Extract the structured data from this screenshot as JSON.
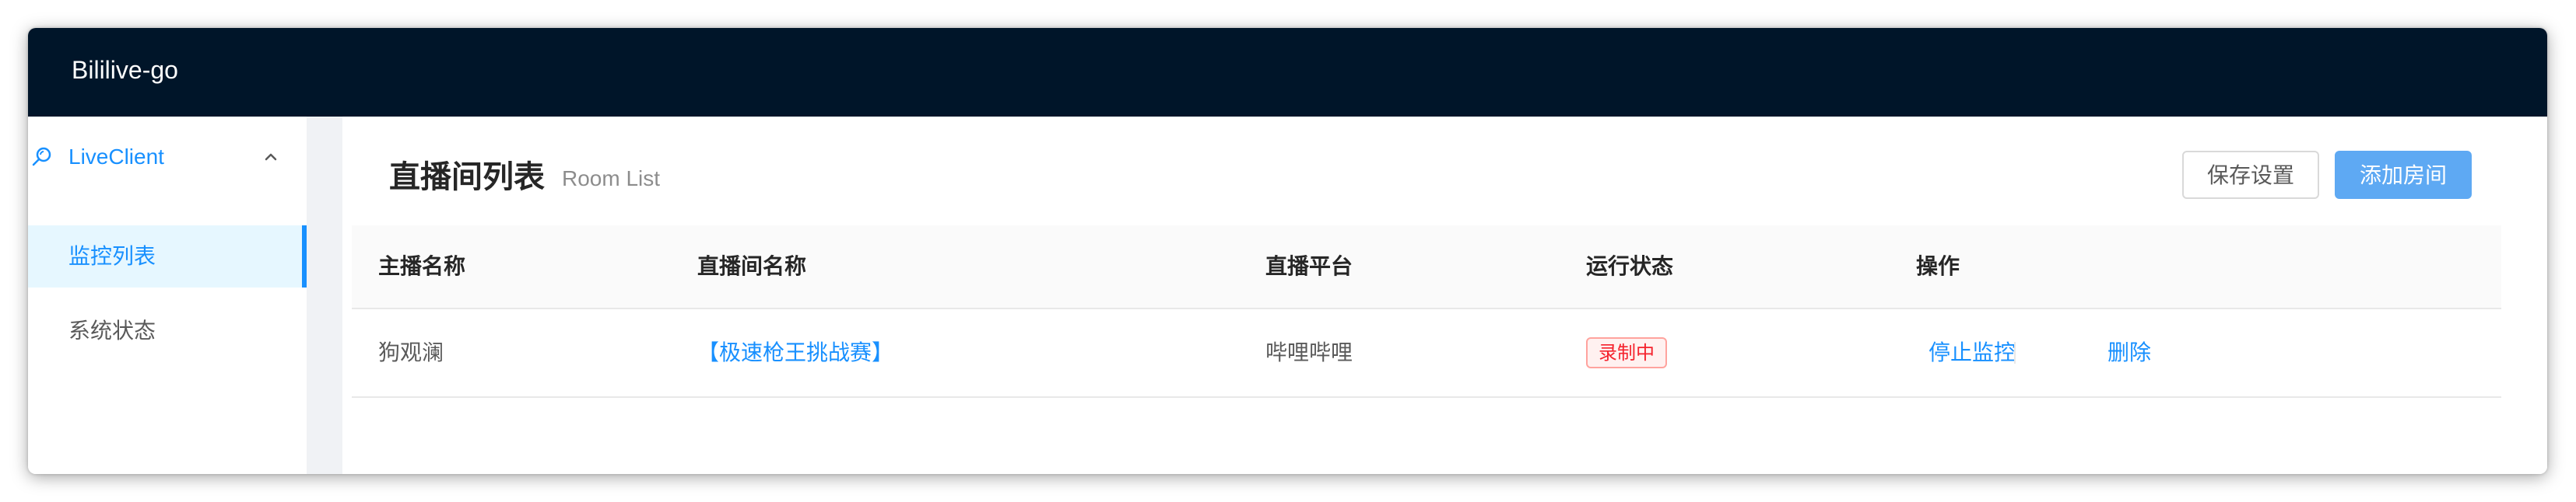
{
  "app": {
    "title": "Bililive-go"
  },
  "sidebar": {
    "group": {
      "label": "LiveClient",
      "icon": "search-icon",
      "expanded": true
    },
    "items": [
      {
        "label": "监控列表",
        "active": true
      },
      {
        "label": "系统状态",
        "active": false
      }
    ]
  },
  "page": {
    "title": "直播间列表",
    "subtitle": "Room List"
  },
  "toolbar": {
    "save_label": "保存设置",
    "add_label": "添加房间"
  },
  "table": {
    "columns": [
      "主播名称",
      "直播间名称",
      "直播平台",
      "运行状态",
      "操作"
    ],
    "rows": [
      {
        "host": "狗观澜",
        "room": "【极速枪王挑战赛】",
        "platform": "哔哩哔哩",
        "status": "录制中",
        "actions": [
          "停止监控",
          "删除"
        ]
      }
    ]
  },
  "colors": {
    "header_bg": "#001529",
    "accent": "#1890ff",
    "primary_button": "#5ea9f3",
    "status_tag": "#f5222d"
  }
}
